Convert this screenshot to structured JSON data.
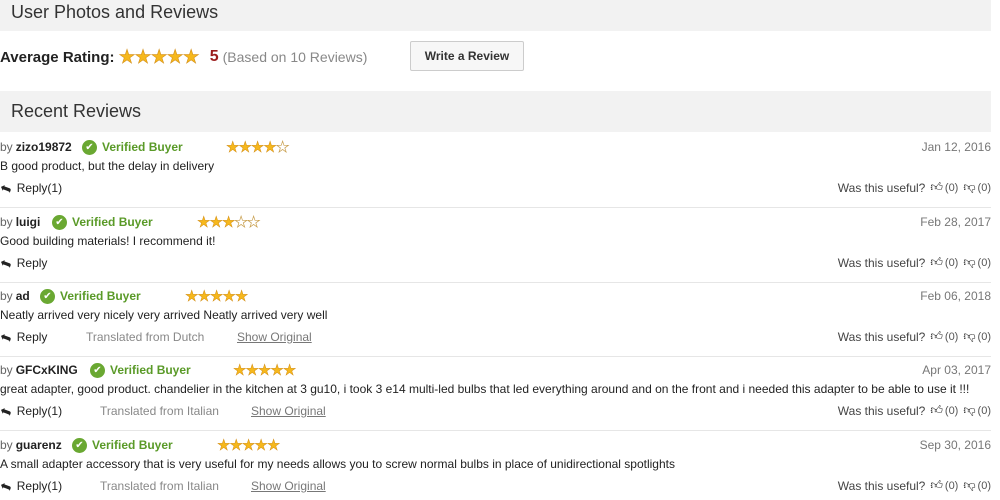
{
  "header": {
    "title": "User Photos and Reviews"
  },
  "average": {
    "label": "Average Rating:",
    "stars": 5,
    "value": "5",
    "count_text": "(Based on 10 Reviews)",
    "write_review": "Write a Review"
  },
  "recent": {
    "title": "Recent Reviews"
  },
  "labels": {
    "by": "by",
    "verified": "Verified Buyer",
    "was_useful": "Was this useful?",
    "show_original": "Show Original"
  },
  "reviews": [
    {
      "user": "zizo19872",
      "rating": 4,
      "date": "Jan 12, 2016",
      "text": "B good product, but the delay in delivery",
      "reply": "Reply(1)",
      "translated": "",
      "show_original": "",
      "up": "(0)",
      "down": "(0)"
    },
    {
      "user": "luigi",
      "rating": 3,
      "date": "Feb 28, 2017",
      "text": "Good building materials! I recommend it!",
      "reply": "Reply",
      "translated": "",
      "show_original": "",
      "up": "(0)",
      "down": "(0)"
    },
    {
      "user": "ad",
      "rating": 5,
      "date": "Feb 06, 2018",
      "text": "Neatly arrived very nicely very arrived Neatly arrived very well",
      "reply": "Reply",
      "translated": "Translated from Dutch",
      "show_original": "Show Original",
      "up": "(0)",
      "down": "(0)"
    },
    {
      "user": "GFCxKING",
      "rating": 5,
      "date": "Apr 03, 2017",
      "text": "great adapter, good product. chandelier in the kitchen at 3 gu10, i took 3 e14 multi-led bulbs that led everything around and on the front and i needed this adapter to be able to use it !!!",
      "reply": "Reply(1)",
      "translated": "Translated from Italian",
      "show_original": "Show Original",
      "up": "(0)",
      "down": "(0)"
    },
    {
      "user": "guarenz",
      "rating": 5,
      "date": "Sep 30, 2016",
      "text": "A small adapter accessory that is very useful for my needs allows you to screw normal bulbs in place of unidirectional spotlights",
      "reply": "Reply(1)",
      "translated": "Translated from Italian",
      "show_original": "Show Original",
      "up": "(0)",
      "down": "(0)"
    }
  ]
}
